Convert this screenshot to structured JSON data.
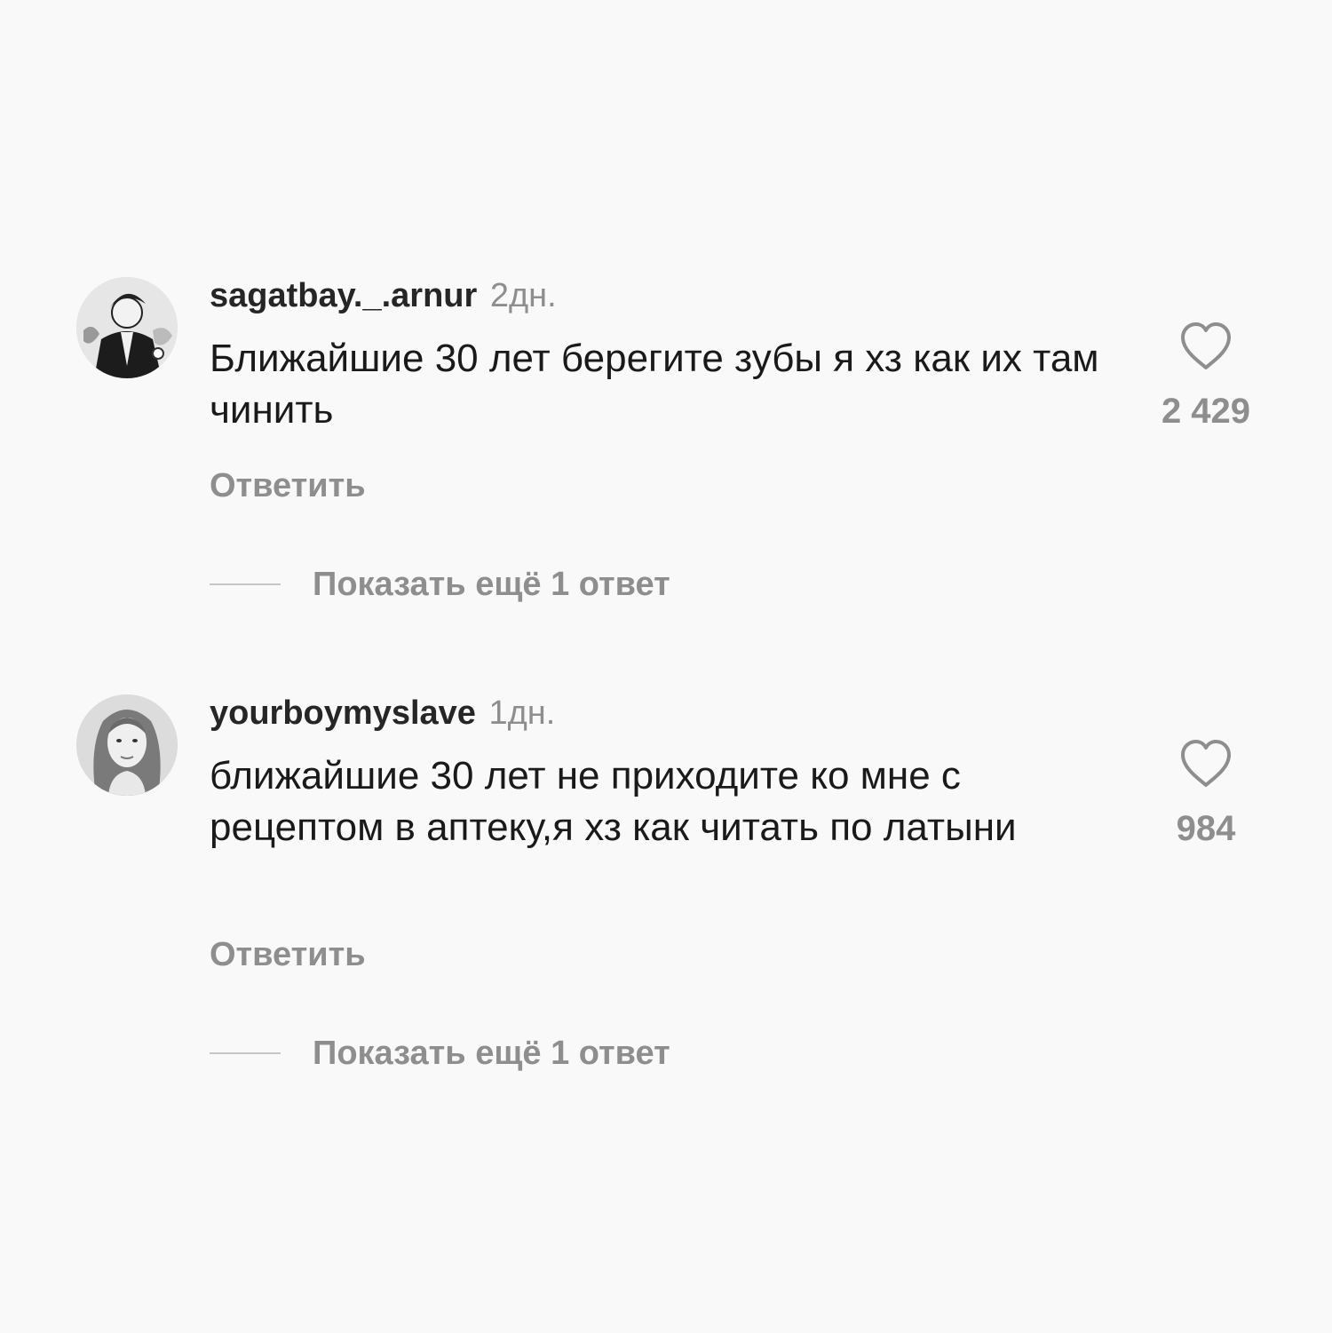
{
  "comments": [
    {
      "username": "sagatbay._.arnur",
      "time": "2дн.",
      "text": "Ближайшие 30 лет берегите зубы я хз как их там чинить",
      "likes": "2 429",
      "reply_label": "Ответить",
      "more_replies_label": "Показать ещё 1 ответ",
      "avatar_icon": "illustrated-character-avatar"
    },
    {
      "username": "yourboymyslave",
      "time": "1дн.",
      "text": "ближайшие 30 лет не приходите ко мне с рецептом в аптеку,я хз как читать по латыни",
      "likes": "984",
      "reply_label": "Ответить",
      "more_replies_label": "Показать ещё 1 ответ",
      "avatar_icon": "portrait-photo-avatar"
    }
  ],
  "icons": {
    "like": "heart-outline-icon"
  },
  "colors": {
    "background": "#f9f9f9",
    "text": "#1a1a1a",
    "muted": "#8e8e8e"
  }
}
